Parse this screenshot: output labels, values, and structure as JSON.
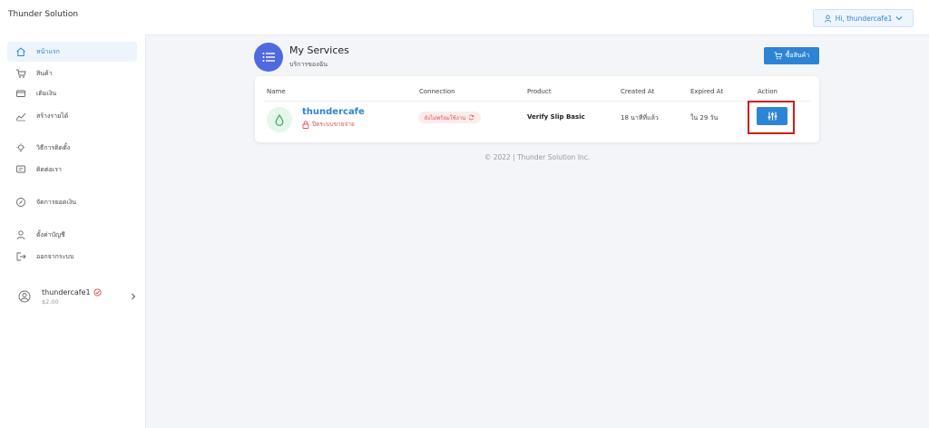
{
  "app": {
    "brand": "Thunder Solution"
  },
  "sidebar": {
    "items": [
      {
        "label": "หน้าแรก",
        "icon": "home-icon",
        "active": true
      },
      {
        "label": "สินค้า",
        "icon": "cart-icon"
      },
      {
        "label": "เติมเงิน",
        "icon": "wallet-icon"
      },
      {
        "label": "สร้างรายได้",
        "icon": "chart-line-icon"
      },
      {
        "label": "วิธีการติดตั้ง",
        "icon": "lightbulb-icon"
      },
      {
        "label": "ติดต่อเรา",
        "icon": "chat-icon"
      },
      {
        "label": "จัดการยอดเงิน",
        "icon": "dollar-icon"
      },
      {
        "label": "ตั้งค่าบัญชี",
        "icon": "user-icon"
      },
      {
        "label": "ออกจากระบบ",
        "icon": "logout-icon"
      }
    ],
    "user": {
      "name": "thundercafe1",
      "balance": "$2.00"
    }
  },
  "header": {
    "user_menu": "Hi, thundercafe1"
  },
  "services": {
    "title": "My Services",
    "subtitle": "บริการของฉัน",
    "buy_button": "ซื้อสินค้า",
    "columns": [
      "Name",
      "Connection",
      "Product",
      "Created At",
      "Expired At",
      "Action"
    ],
    "rows": [
      {
        "name": "thundercafe",
        "status": "ปิดระบบขายจ่าย",
        "connection": "ยังไม่พร้อมใช้งาน",
        "product": "Verify Slip Basic",
        "created_at": "18 นาทีที่แล้ว",
        "expired_at": "ใน 29 วัน"
      }
    ]
  },
  "footer": {
    "text": "© 2022 | Thunder Solution Inc."
  },
  "colors": {
    "accent": "#2d84d6",
    "danger": "#e05252",
    "highlight": "#d11b1b",
    "service_icon": "#4f6ae0"
  }
}
